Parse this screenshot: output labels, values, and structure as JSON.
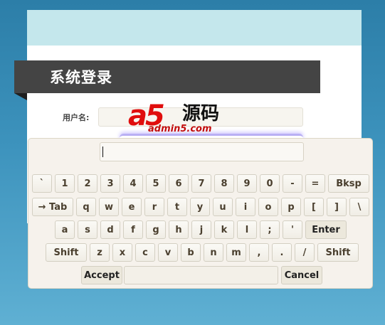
{
  "page": {
    "title": "系统登录",
    "username_label": "用户名:",
    "username_value": "",
    "logo": {
      "brand": "a5",
      "chinese": "源码",
      "url": "admin5.com"
    }
  },
  "keyboard": {
    "preview_value": "",
    "keys": {
      "backtick": "`",
      "k1": "1",
      "k2": "2",
      "k3": "3",
      "k4": "4",
      "k5": "5",
      "k6": "6",
      "k7": "7",
      "k8": "8",
      "k9": "9",
      "k0": "0",
      "minus": "-",
      "equals": "=",
      "bksp": "Bksp",
      "tab": "→ Tab",
      "q": "q",
      "w": "w",
      "e": "e",
      "r": "r",
      "t": "t",
      "y": "y",
      "u": "u",
      "i": "i",
      "o": "o",
      "p": "p",
      "lbracket": "[",
      "rbracket": "]",
      "backslash": "\\",
      "a": "a",
      "s": "s",
      "d": "d",
      "f": "f",
      "g": "g",
      "h": "h",
      "j": "j",
      "k": "k",
      "l": "l",
      "semicolon": ";",
      "quote": "'",
      "enter": "Enter",
      "shift_left": "Shift",
      "z": "z",
      "x": "x",
      "c": "c",
      "v": "v",
      "b": "b",
      "n": "n",
      "m": "m",
      "comma": ",",
      "period": ".",
      "slash": "/",
      "shift_right": "Shift",
      "accept": "Accept",
      "space": "",
      "cancel": "Cancel"
    }
  }
}
